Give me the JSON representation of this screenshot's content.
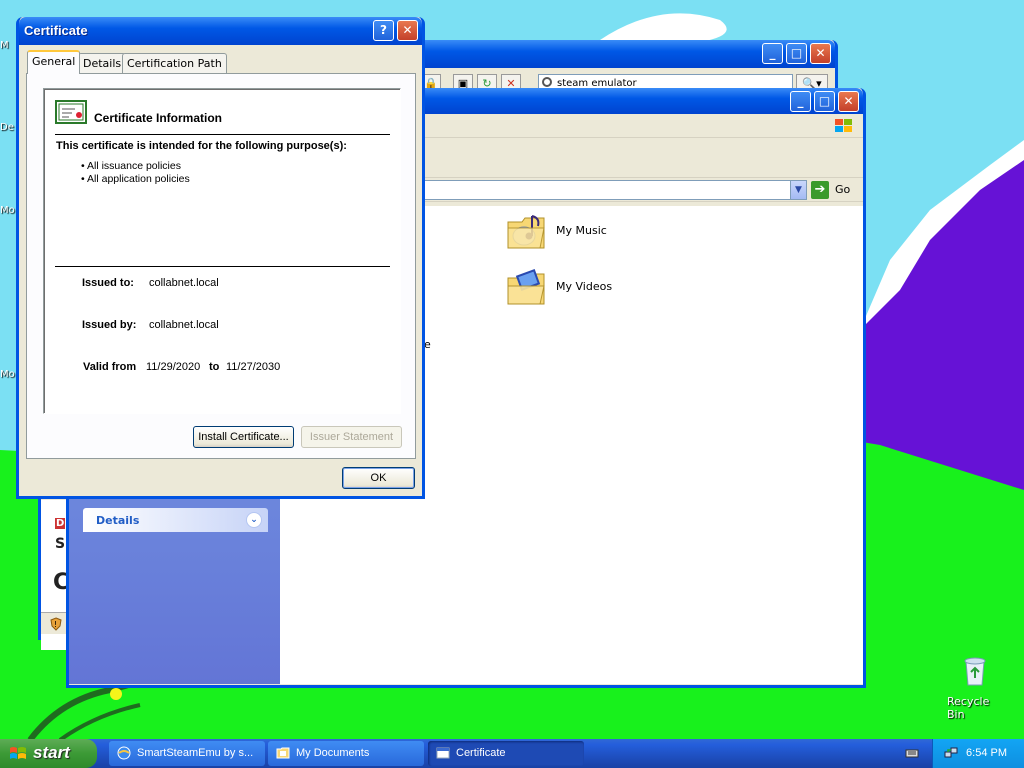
{
  "desktop": {
    "recycle_bin_label": "Recycle Bin",
    "edge_labels": [
      "M",
      "De",
      "Mo",
      "Mo"
    ]
  },
  "back_window": {
    "search_text": "steam emulator",
    "partial_text": [
      "D",
      "S",
      "C"
    ]
  },
  "docs_window": {
    "go_label": "Go",
    "details_label": "Details",
    "items": [
      {
        "label": "My Music",
        "icon": "music-folder-icon"
      },
      {
        "label": "My Videos",
        "icon": "video-folder-icon"
      }
    ],
    "partial_e": "e"
  },
  "certificate_dialog": {
    "title": "Certificate",
    "help_glyph": "?",
    "close_glyph": "✕",
    "tabs": [
      {
        "label": "General",
        "active": true
      },
      {
        "label": "Details",
        "active": false
      },
      {
        "label": "Certification Path",
        "active": false
      }
    ],
    "info_title": "Certificate Information",
    "purpose_heading": "This certificate is intended for the following purpose(s):",
    "purposes": [
      "• All issuance policies",
      "• All application policies"
    ],
    "issued_to_label": "Issued to:",
    "issued_to_value": "collabnet.local",
    "issued_by_label": "Issued by:",
    "issued_by_value": "collabnet.local",
    "valid_from_label": "Valid from",
    "valid_from_value": "11/29/2020",
    "valid_to_label": "to",
    "valid_to_value": "11/27/2030",
    "install_button": "Install Certificate...",
    "issuer_statement_button": "Issuer Statement",
    "ok_button": "OK"
  },
  "taskbar": {
    "start_label": "start",
    "buttons": [
      {
        "label": "SmartSteamEmu by s...",
        "icon": "browser-icon",
        "active": false
      },
      {
        "label": "My Documents",
        "icon": "folder-icon",
        "active": false
      },
      {
        "label": "Certificate",
        "icon": "certificate-icon",
        "active": true
      }
    ],
    "clock": "6:54 PM"
  },
  "colors": {
    "sky": "#7be0f3",
    "grass": "#18f11c",
    "mountain": "#6612d6",
    "xp_blue": "#0054e3",
    "dialog_face": "#ece9d8"
  }
}
